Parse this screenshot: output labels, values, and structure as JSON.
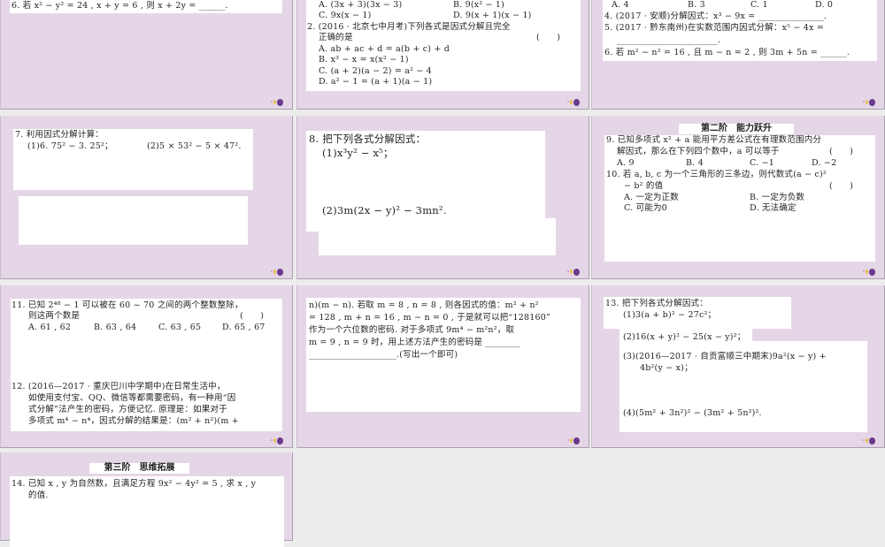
{
  "slides": [
    {
      "lines": [
        "6. 若 x² − y² = 24 , x + y = 6 , 则 x + 2y = ______."
      ]
    },
    {
      "lines": [
        "A. (3x + 3)(3x − 3)",
        "B. 9(x² − 1)",
        "C. 9x(x − 1)",
        "D. 9(x + 1)(x − 1)",
        "2. (2016 · 北京七中月考)下列各式是因式分解且完全",
        "正确的是",
        "(　　)",
        "A. ab + ac + d = a(b + c) + d",
        "B. x³ − x = x(x² − 1)",
        "C. (a + 2)(a − 2) = a² − 4",
        "D. a² − 1 = (a + 1)(a − 1)"
      ]
    },
    {
      "lines": [
        "A. 4",
        "B. 3",
        "C. 1",
        "D. 0",
        "4. (2017 · 安顺)分解因式：x³ − 9x = _______________.",
        "5. (2017 · 黔东南州)在实数范围内因式分解：x⁵ − 4x =",
        "_______________________.",
        "6. 若 m² − n² = 16 , 且 m − n = 2 , 则 3m + 5n = ______."
      ]
    },
    {
      "lines": [
        "7. 利用因式分解计算：",
        "(1)6. 75² − 3. 25²；",
        "(2)5 × 53² − 5 × 47²."
      ]
    },
    {
      "lines": [
        "8. 把下列各式分解因式：",
        "(1)x³y² − x⁵；",
        "(2)3m(2x − y)² − 3mn²."
      ]
    },
    {
      "heading": "第二阶　能力跃升",
      "lines": [
        "9. 已知多项式 x² + a 能用平方差公式在有理数范围内分",
        "解因式，那么在下列四个数中，a 可以等于",
        "(　　)",
        "A. 9",
        "B. 4",
        "C. −1",
        "D. −2",
        "10. 若 a, b, c 为一个三角形的三条边，则代数式(a − c)²",
        "− b² 的值",
        "(　　)",
        "A. 一定为正数",
        "B. 一定为负数",
        "C. 可能为0",
        "D. 无法确定"
      ]
    },
    {
      "lines": [
        "11. 已知 2⁴⁸ − 1 可以被在 60 ~ 70 之间的两个整数整除，",
        "则这两个数是",
        "(　　)",
        "A. 61 , 62",
        "B. 63 , 64",
        "C. 63 , 65",
        "D. 65 , 67",
        "12. (2016—2017 · 重庆巴川中学期中)在日常生活中，",
        "如使用支付宝、QQ、微信等都需要密码，有一种用“因",
        "式分解”法产生的密码，方便记忆. 原理是：如果对于",
        "多项式 m⁴ − n⁴，因式分解的结果是：(m² + n²)(m +"
      ]
    },
    {
      "lines": [
        "n)(m − n). 若取 m = 8 , n = 8 , 则各因式的值：m² + n²",
        "= 128 , m + n = 16 , m − n = 0 , 于是就可以把“128160”",
        "作为一个六位数的密码. 对于多项式 9m⁴ − m²n²，取",
        "m = 9 , n = 9 时，用上述方法产生的密码是 ________",
        "____________________.(写出一个即可)"
      ]
    },
    {
      "lines": [
        "13. 把下列各式分解因式：",
        "(1)3(a + b)² − 27c²；",
        "(2)16(x + y)² − 25(x − y)²；",
        "(3)(2016—2017 · 自贡富顺三中期末)9a²(x − y) +",
        "4b²(y − x)；",
        "(4)(5m² + 3n²)² − (3m² + 5n²)²."
      ]
    },
    {
      "heading": "第三阶　思维拓展",
      "lines": [
        "14. 已知 x , y 为自然数，且满足方程 9x² − 4y² = 5 , 求 x , y",
        "的值."
      ]
    }
  ],
  "colors": {
    "slide_bg": "#e5d6e7",
    "accent": "#6a3a8c"
  }
}
